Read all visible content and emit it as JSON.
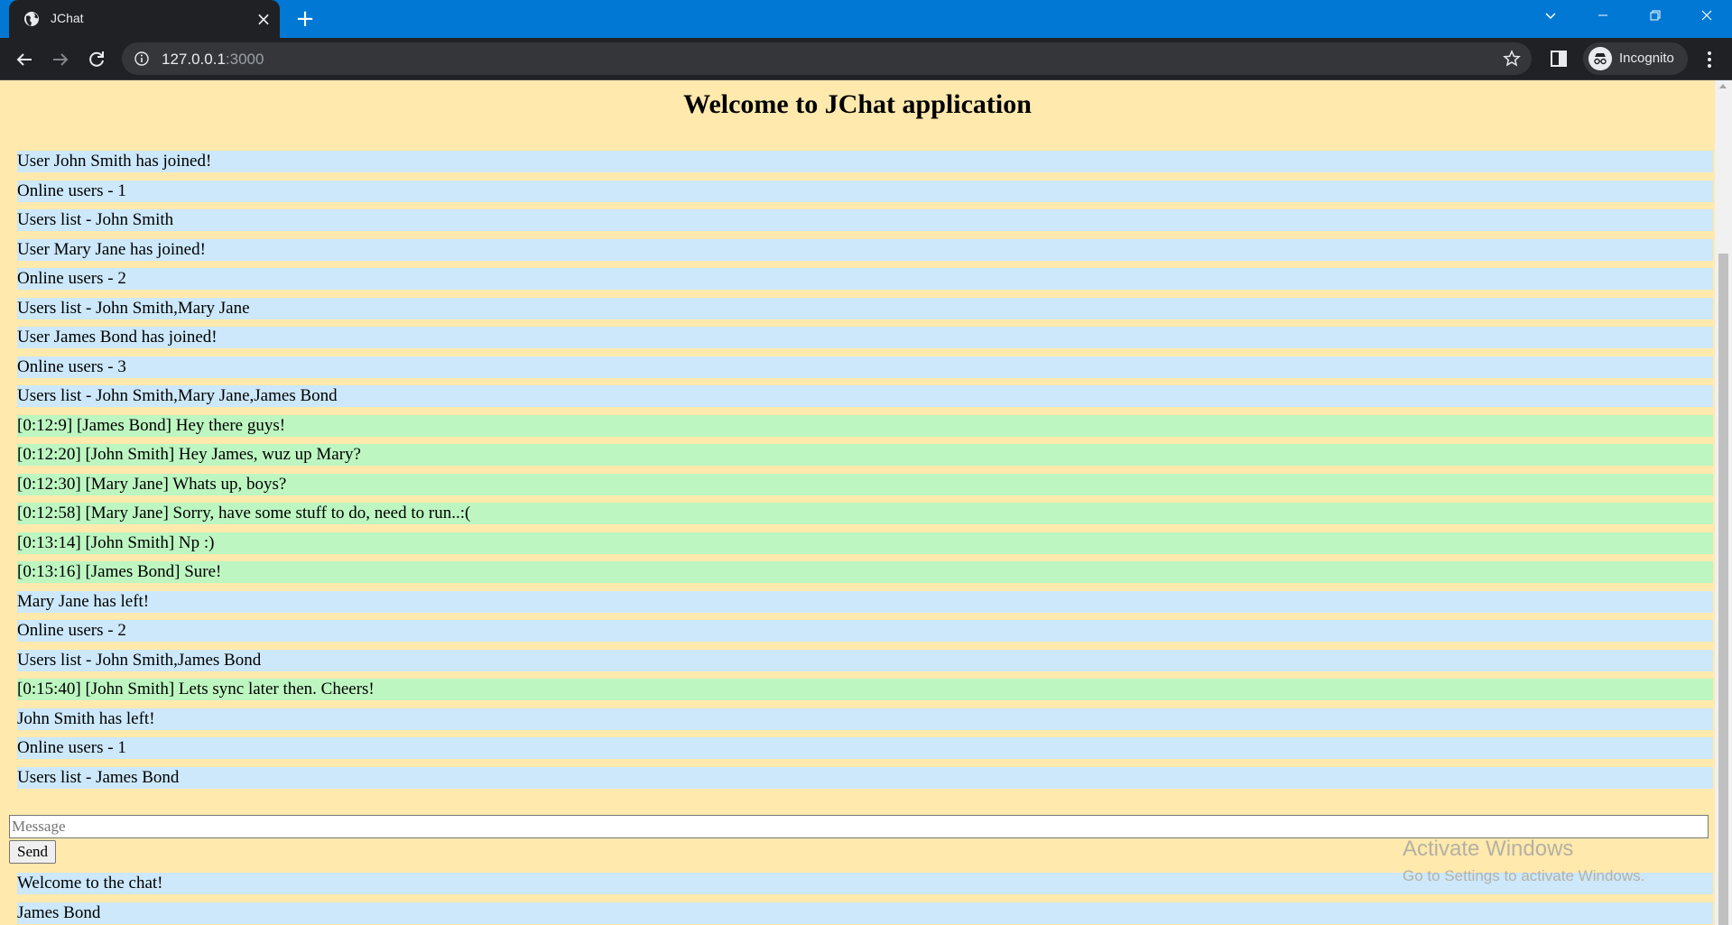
{
  "browser": {
    "tab_title": "JChat",
    "url_host": "127.0.0.1",
    "url_port": ":3000",
    "profile_label": "Incognito"
  },
  "page": {
    "title": "Welcome to JChat application"
  },
  "messages": [
    {
      "kind": "sys",
      "text": "User John Smith has joined!"
    },
    {
      "kind": "sys",
      "text": "Online users - 1"
    },
    {
      "kind": "sys",
      "text": "Users list - John Smith"
    },
    {
      "kind": "sys",
      "text": "User Mary Jane has joined!"
    },
    {
      "kind": "sys",
      "text": "Online users - 2"
    },
    {
      "kind": "sys",
      "text": "Users list - John Smith,Mary Jane"
    },
    {
      "kind": "sys",
      "text": "User James Bond has joined!"
    },
    {
      "kind": "sys",
      "text": "Online users - 3"
    },
    {
      "kind": "sys",
      "text": "Users list - John Smith,Mary Jane,James Bond"
    },
    {
      "kind": "chat",
      "text": "[0:12:9] [James Bond] Hey there guys!"
    },
    {
      "kind": "chat",
      "text": "[0:12:20] [John Smith] Hey James, wuz up Mary?"
    },
    {
      "kind": "chat",
      "text": "[0:12:30] [Mary Jane] Whats up, boys?"
    },
    {
      "kind": "chat",
      "text": "[0:12:58] [Mary Jane] Sorry, have some stuff to do, need to run..:("
    },
    {
      "kind": "chat",
      "text": "[0:13:14] [John Smith] Np :)"
    },
    {
      "kind": "chat",
      "text": "[0:13:16] [James Bond] Sure!"
    },
    {
      "kind": "sys",
      "text": "Mary Jane has left!"
    },
    {
      "kind": "sys",
      "text": "Online users - 2"
    },
    {
      "kind": "sys",
      "text": "Users list - John Smith,James Bond"
    },
    {
      "kind": "chat",
      "text": "[0:15:40] [John Smith] Lets sync later then. Cheers!"
    },
    {
      "kind": "sys",
      "text": "John Smith has left!"
    },
    {
      "kind": "sys",
      "text": "Online users - 1"
    },
    {
      "kind": "sys",
      "text": "Users list - James Bond"
    }
  ],
  "composer": {
    "placeholder": "Message",
    "value": "",
    "send_label": "Send"
  },
  "footer": {
    "welcome": "Welcome to the chat!",
    "username": "James Bond"
  },
  "watermark": {
    "title": "Activate Windows",
    "subtitle": "Go to Settings to activate Windows."
  },
  "colors": {
    "page_background": "#ffe9ad",
    "system_message_background": "#cce8fa",
    "chat_message_background": "#bdf6c1",
    "tabstrip": "#0078d4"
  }
}
